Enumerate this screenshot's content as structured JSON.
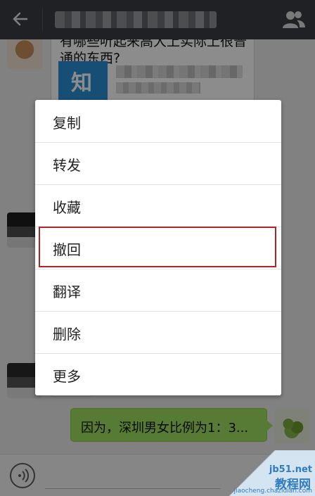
{
  "header": {
    "back_icon": "arrow-left-icon",
    "contact_icon": "contacts-icon"
  },
  "chat": {
    "card_message": {
      "title": "有哪些听起来高大上实际上很普通的东西?",
      "thumb_text": "知"
    },
    "my_message": {
      "text": "因为，深圳男女比例为1：3..."
    }
  },
  "context_menu": {
    "items": [
      {
        "label": "复制"
      },
      {
        "label": "转发"
      },
      {
        "label": "收藏"
      },
      {
        "label": "撤回"
      },
      {
        "label": "翻译"
      },
      {
        "label": "删除"
      },
      {
        "label": "更多"
      }
    ],
    "highlight_color": "#b1242a"
  },
  "input_bar": {
    "voice_icon": "voice-icon"
  },
  "watermark": {
    "line1": "jb51.net",
    "line2": "教程网",
    "line3": "jiaocheng.chazidian.com"
  },
  "colors": {
    "header_bg": "#3a3d43",
    "my_bubble": "#9fe15f",
    "chat_bg": "#ebebeb"
  }
}
